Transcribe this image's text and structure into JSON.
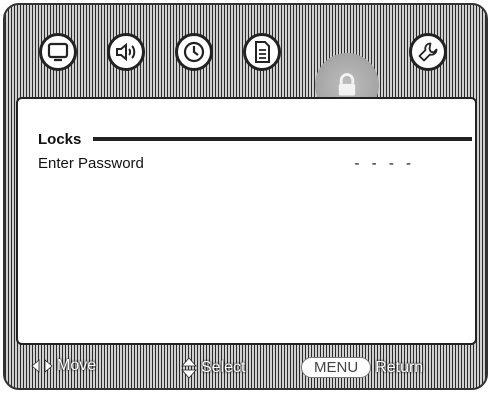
{
  "topbar": {
    "icons": [
      "picture-icon",
      "audio-icon",
      "clock-icon",
      "setup-icon",
      "lock-icon",
      "wrench-icon"
    ],
    "active": "lock-icon"
  },
  "panel": {
    "title": "Locks",
    "rows": [
      {
        "label": "Enter Password",
        "value": "- - - -"
      }
    ]
  },
  "footer": {
    "move_label": "Move",
    "select_label": "Select",
    "menu_button": "MENU",
    "return_label": "Return"
  }
}
